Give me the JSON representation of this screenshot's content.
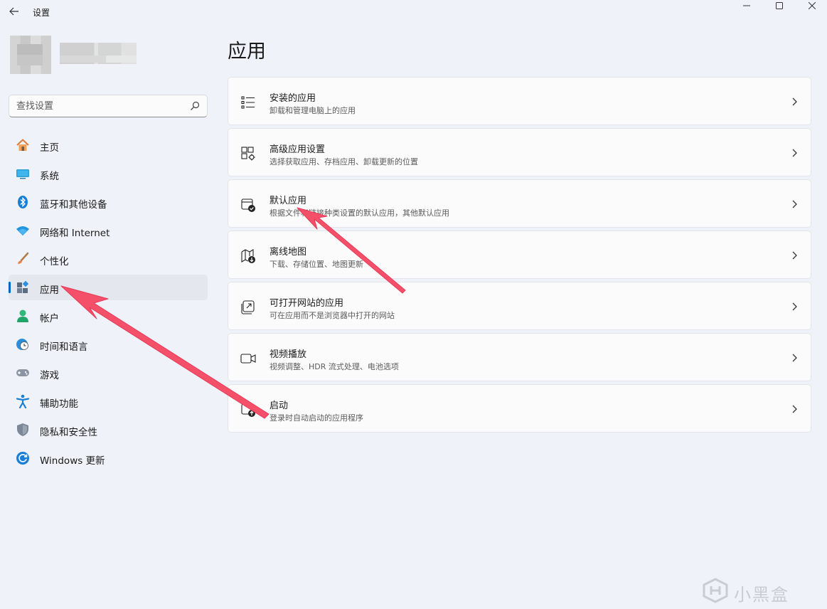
{
  "window": {
    "title": "设置"
  },
  "search": {
    "placeholder": "查找设置"
  },
  "sidebar": {
    "items": [
      {
        "label": "主页",
        "icon": "home-icon",
        "selected": false
      },
      {
        "label": "系统",
        "icon": "monitor-icon",
        "selected": false
      },
      {
        "label": "蓝牙和其他设备",
        "icon": "bluetooth-icon",
        "selected": false
      },
      {
        "label": "网络和 Internet",
        "icon": "wifi-icon",
        "selected": false
      },
      {
        "label": "个性化",
        "icon": "brush-icon",
        "selected": false
      },
      {
        "label": "应用",
        "icon": "apps-icon",
        "selected": true
      },
      {
        "label": "帐户",
        "icon": "person-icon",
        "selected": false
      },
      {
        "label": "时间和语言",
        "icon": "globe-clock-icon",
        "selected": false
      },
      {
        "label": "游戏",
        "icon": "gamepad-icon",
        "selected": false
      },
      {
        "label": "辅助功能",
        "icon": "accessibility-icon",
        "selected": false
      },
      {
        "label": "隐私和安全性",
        "icon": "shield-icon",
        "selected": false
      },
      {
        "label": "Windows 更新",
        "icon": "update-icon",
        "selected": false
      }
    ]
  },
  "main": {
    "title": "应用",
    "cards": [
      {
        "title": "安装的应用",
        "subtitle": "卸载和管理电脑上的应用",
        "icon": "list-icon"
      },
      {
        "title": "高级应用设置",
        "subtitle": "选择获取应用、存档应用、卸载更新的位置",
        "icon": "app-settings-icon"
      },
      {
        "title": "默认应用",
        "subtitle": "根据文件和链接种类设置的默认应用，其他默认应用",
        "icon": "default-app-icon"
      },
      {
        "title": "离线地图",
        "subtitle": "下载、存储位置、地图更新",
        "icon": "map-download-icon"
      },
      {
        "title": "可打开网站的应用",
        "subtitle": "可在应用而不是浏览器中打开的网站",
        "icon": "open-external-icon"
      },
      {
        "title": "视频播放",
        "subtitle": "视频调整、HDR 流式处理、电池选项",
        "icon": "video-icon"
      },
      {
        "title": "启动",
        "subtitle": "登录时自动启动的应用程序",
        "icon": "startup-icon"
      }
    ]
  },
  "colors": {
    "accent": "#0067c0",
    "annotation_arrow": "#f4506a",
    "background": "#eff3f9"
  },
  "watermark": {
    "text": "小黑盒"
  }
}
